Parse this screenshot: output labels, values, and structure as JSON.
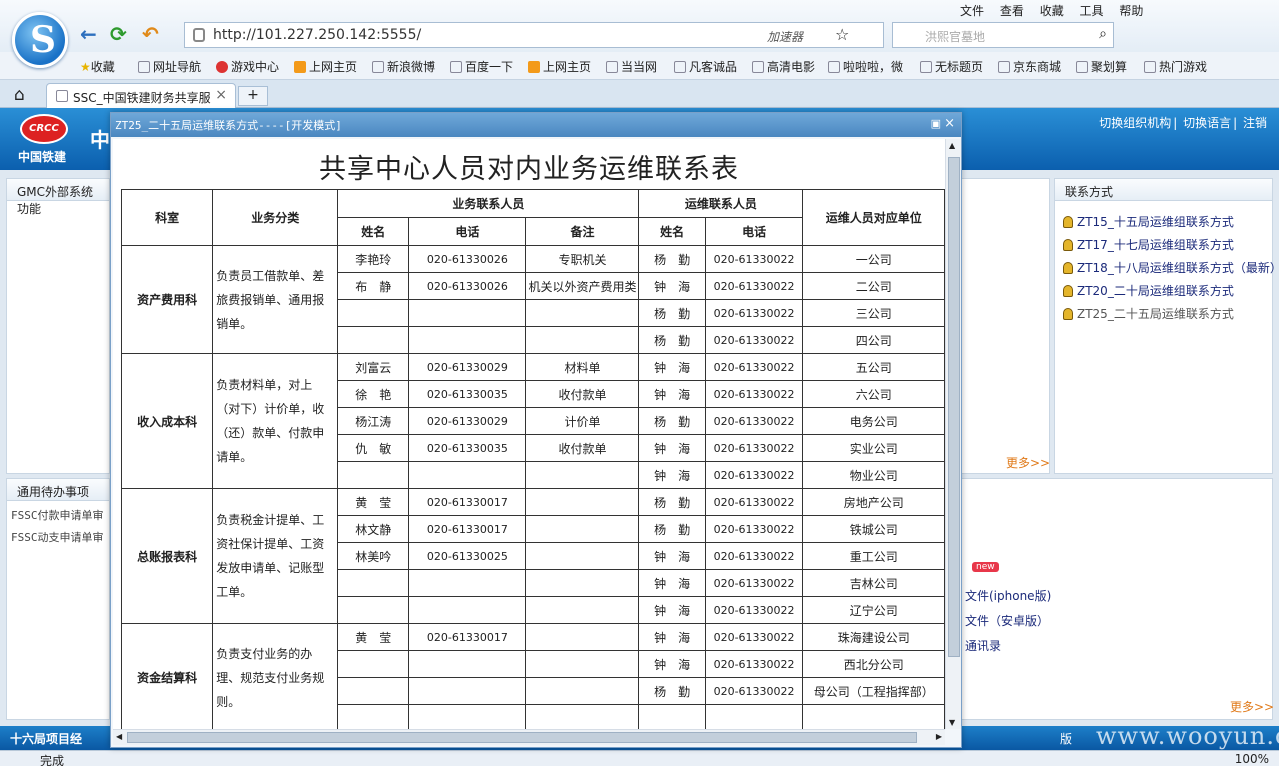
{
  "browser": {
    "url": "http://101.227.250.142:5555/",
    "accelerator": "加速器",
    "search_placeholder": "洪熙官墓地",
    "menu": [
      "文件",
      "查看",
      "收藏",
      "工具",
      "帮助"
    ],
    "favorites": [
      "收藏",
      "网址导航",
      "游戏中心",
      "上网主页",
      "新浪微博",
      "百度一下",
      "上网主页",
      "当当网",
      "凡客诚品",
      "高清电影",
      "啦啦啦，微",
      "无标题页",
      "京东商城",
      "聚划算",
      "热门游戏"
    ],
    "tab_title": "SSC_中国铁建财务共享服",
    "tab_new": "+",
    "status": "完成",
    "zoom": "100%"
  },
  "page": {
    "brand": "中国铁建",
    "logo_text": "CRCC",
    "header_title": "中",
    "header_links": [
      "切换组织机构",
      "切换语言",
      "注销"
    ],
    "gmc_panel_title": "GMC外部系统功能",
    "todo_panel_title": "通用待办事项",
    "todo_items": [
      "FSSC付款申请单审",
      "FSSC动支申请单审"
    ],
    "contact_panel_title": "联系方式",
    "contact_items": [
      "ZT15_十五局运维组联系方式",
      "ZT17_十七局运维组联系方式",
      "ZT18_十八局运维组联系方式（最新）",
      "ZT20_二十局运维组联系方式",
      "ZT25_二十五局运维联系方式"
    ],
    "more_label": "更多>>",
    "new_badge": "new",
    "app_links": [
      "文件(iphone版)",
      "文件（安卓版）",
      "通讯录"
    ],
    "bottom_left": "十六局项目经",
    "bottom_right": "版",
    "watermark": "www.wooyun.org"
  },
  "modal": {
    "title": "ZT25_二十五局运维联系方式----[开发模式]",
    "heading": "共享中心人员对内业务运维联系表",
    "headers": {
      "dept": "科室",
      "category": "业务分类",
      "biz_contact": "业务联系人员",
      "ops_contact": "运维联系人员",
      "ops_unit": "运维人员对应单位",
      "name": "姓名",
      "phone": "电话",
      "note": "备注"
    },
    "sections": [
      {
        "dept": "资产费用科",
        "category": "负责员工借款单、差旅费报销单、通用报销单。",
        "rows": [
          [
            "李艳玲",
            "020-61330026",
            "专职机关",
            "杨　勤",
            "020-61330022",
            "一公司"
          ],
          [
            "布　静",
            "020-61330026",
            "机关以外资产费用类",
            "钟　海",
            "020-61330022",
            "二公司"
          ],
          [
            "",
            "",
            "",
            "杨　勤",
            "020-61330022",
            "三公司"
          ],
          [
            "",
            "",
            "",
            "杨　勤",
            "020-61330022",
            "四公司"
          ]
        ]
      },
      {
        "dept": "收入成本科",
        "category": "负责材料单，对上（对下）计价单，收（还）款单、付款申请单。",
        "rows": [
          [
            "刘富云",
            "020-61330029",
            "材料单",
            "钟　海",
            "020-61330022",
            "五公司"
          ],
          [
            "徐　艳",
            "020-61330035",
            "收付款单",
            "钟　海",
            "020-61330022",
            "六公司"
          ],
          [
            "杨江涛",
            "020-61330029",
            "计价单",
            "杨　勤",
            "020-61330022",
            "电务公司"
          ],
          [
            "仇　敏",
            "020-61330035",
            "收付款单",
            "钟　海",
            "020-61330022",
            "实业公司"
          ],
          [
            "",
            "",
            "",
            "钟　海",
            "020-61330022",
            "物业公司"
          ]
        ]
      },
      {
        "dept": "总账报表科",
        "category": "负责税金计提单、工资社保计提单、工资发放申请单、记账型工单。",
        "rows": [
          [
            "黄　莹",
            "020-61330017",
            "",
            "杨　勤",
            "020-61330022",
            "房地产公司"
          ],
          [
            "林文静",
            "020-61330017",
            "",
            "杨　勤",
            "020-61330022",
            "铁城公司"
          ],
          [
            "林美吟",
            "020-61330025",
            "",
            "钟　海",
            "020-61330022",
            "重工公司"
          ],
          [
            "",
            "",
            "",
            "钟　海",
            "020-61330022",
            "吉林公司"
          ],
          [
            "",
            "",
            "",
            "钟　海",
            "020-61330022",
            "辽宁公司"
          ]
        ]
      },
      {
        "dept": "资金结算科",
        "category": "负责支付业务的办理、规范支付业务规则。",
        "rows": [
          [
            "黄　莹",
            "020-61330017",
            "",
            "钟　海",
            "020-61330022",
            "珠海建设公司"
          ],
          [
            "",
            "",
            "",
            "钟　海",
            "020-61330022",
            "西北分公司"
          ],
          [
            "",
            "",
            "",
            "杨　勤",
            "020-61330022",
            "母公司（工程指挥部）"
          ],
          [
            "",
            "",
            "",
            "",
            "",
            ""
          ]
        ]
      }
    ]
  },
  "colors": {
    "brand_blue": "#0b5fae",
    "link_blue": "#1b2a7a",
    "more_orange": "#e07a1a"
  }
}
